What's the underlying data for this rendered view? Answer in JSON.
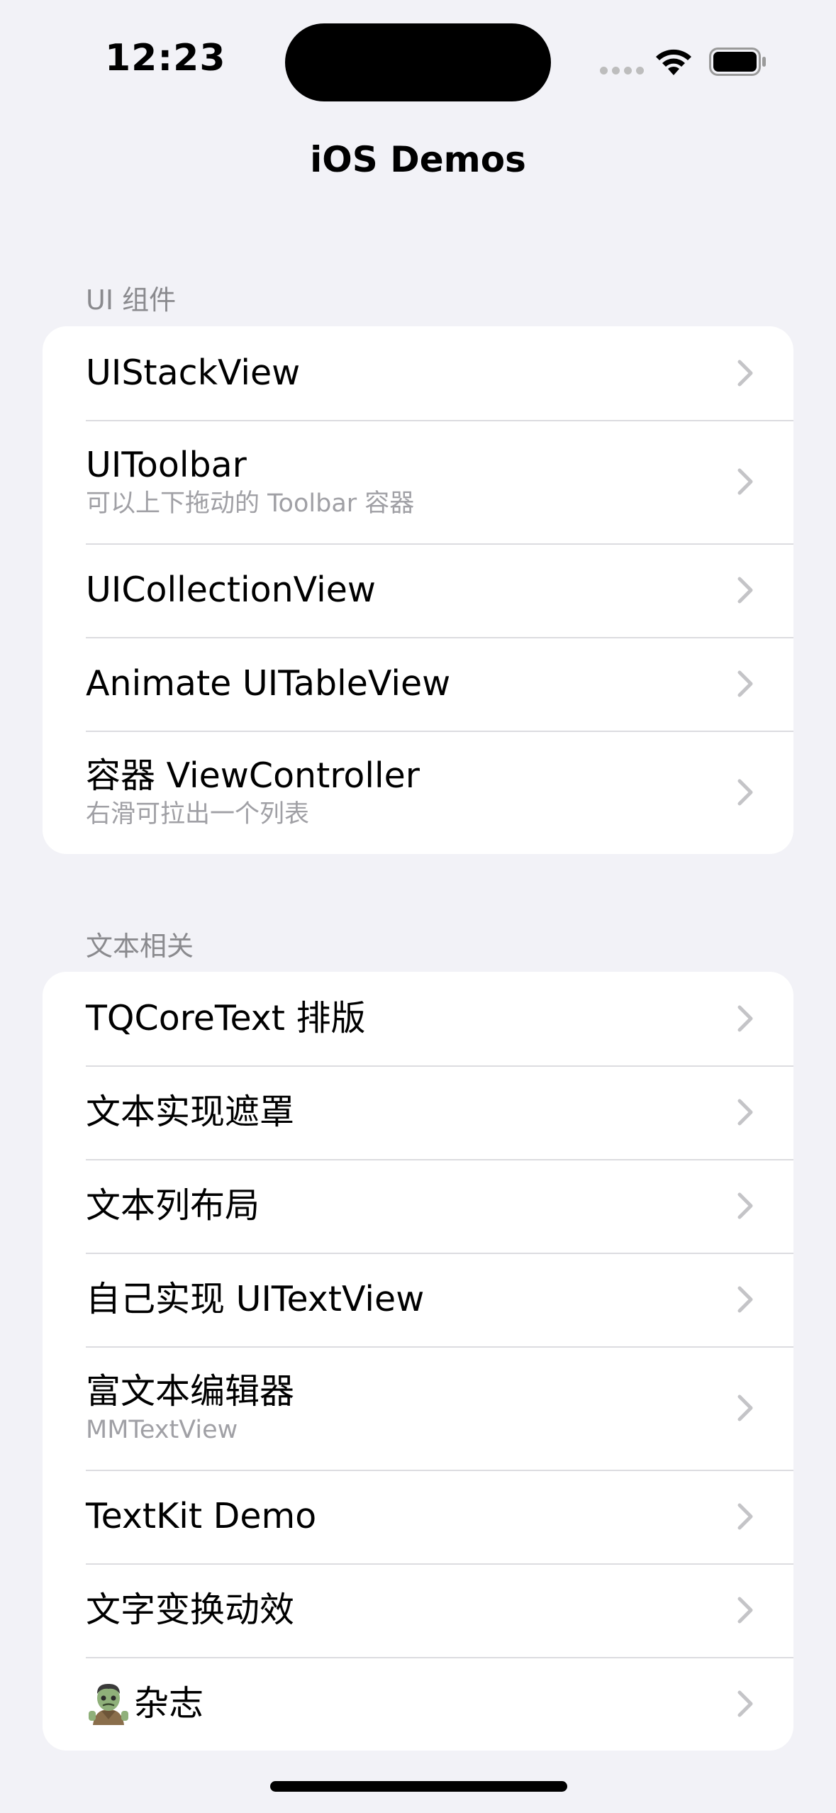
{
  "status_bar": {
    "time": "12:23"
  },
  "nav": {
    "title": "iOS Demos"
  },
  "sections": [
    {
      "header": "UI 组件",
      "rows": [
        {
          "title": "UIStackView"
        },
        {
          "title": "UIToolbar",
          "subtitle": "可以上下拖动的 Toolbar 容器"
        },
        {
          "title": "UICollectionView"
        },
        {
          "title": "Animate UITableView"
        },
        {
          "title": "容器 ViewController",
          "subtitle": "右滑可拉出一个列表"
        }
      ]
    },
    {
      "header": "文本相关",
      "rows": [
        {
          "title": "TQCoreText 排版"
        },
        {
          "title": "文本实现遮罩"
        },
        {
          "title": "文本列布局"
        },
        {
          "title": "自己实现 UITextView"
        },
        {
          "title": "富文本编辑器",
          "subtitle": "MMTextView"
        },
        {
          "title": "TextKit Demo"
        },
        {
          "title": "文字变换动效"
        },
        {
          "title": "杂志",
          "icon": "zombie-emoji-icon"
        }
      ]
    }
  ],
  "colors": {
    "background": "#F2F2F7",
    "card": "#FFFFFF",
    "secondary_text": "#A0A0A5",
    "section_header": "#8A8A8E",
    "separator": "#DCDCE0",
    "chevron": "#C4C4C7"
  }
}
